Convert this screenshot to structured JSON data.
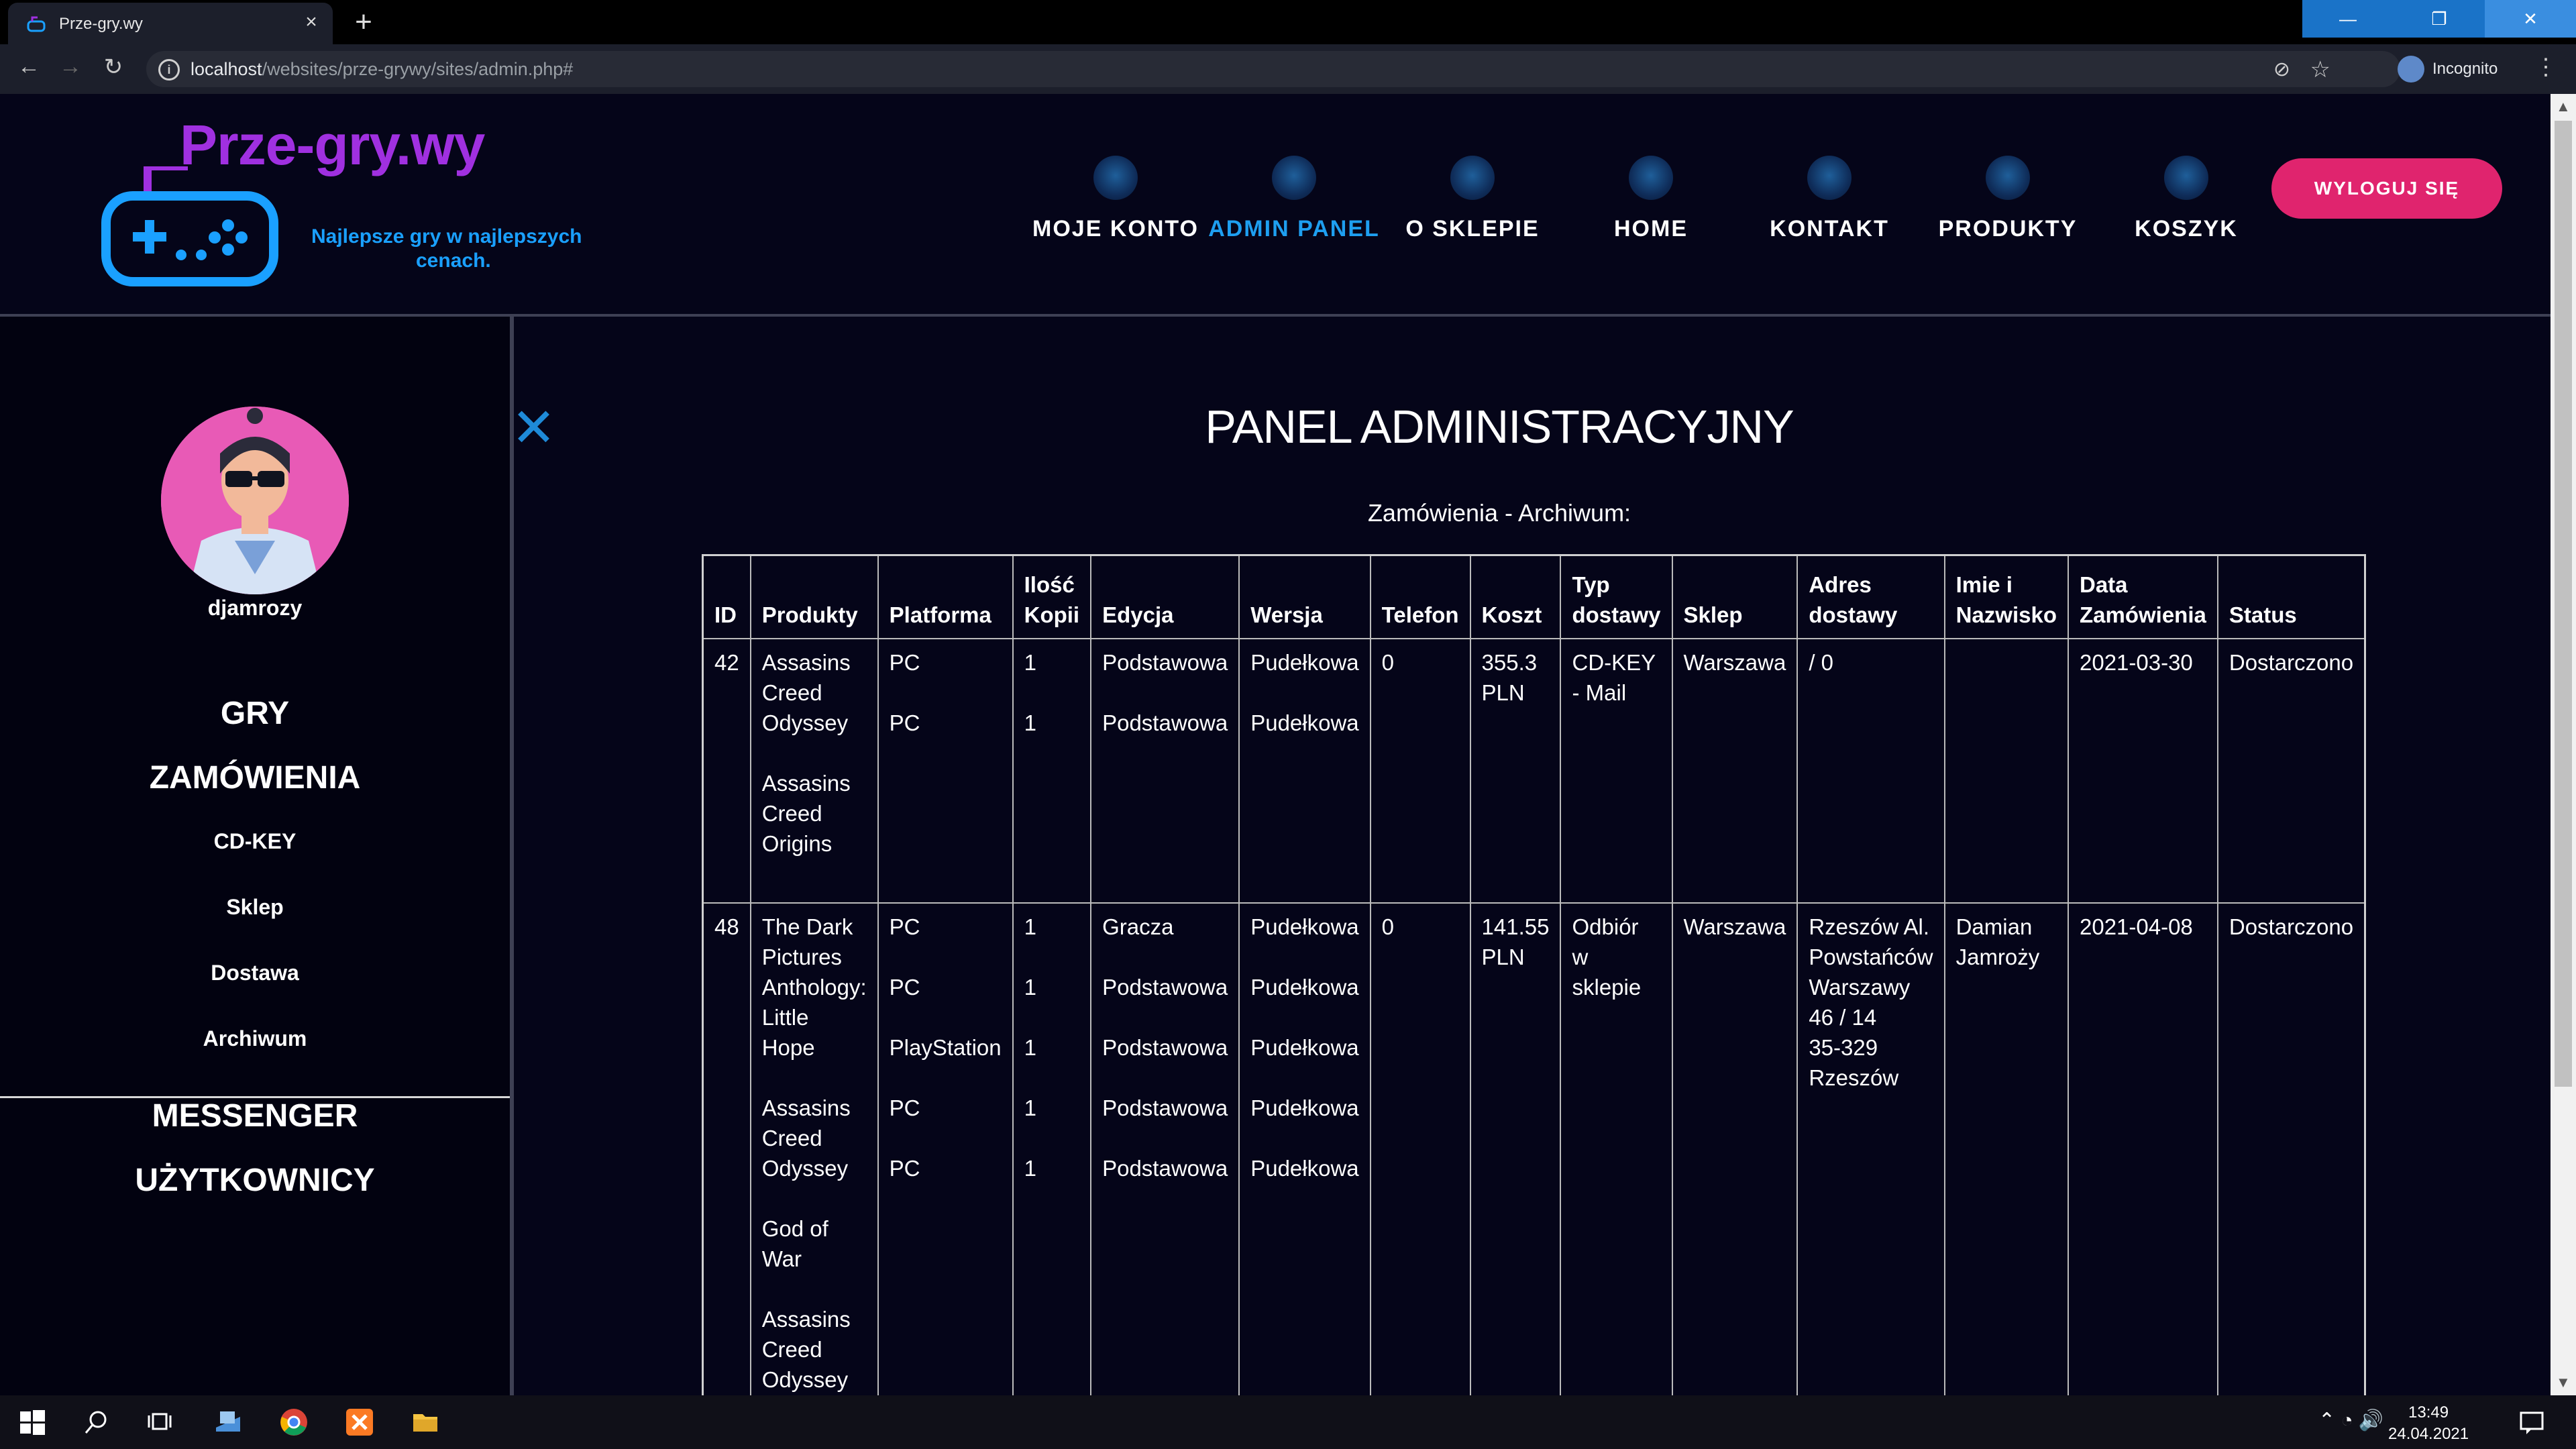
{
  "browser": {
    "tab_title": "Prze-gry.wy",
    "tab_close": "×",
    "new_tab": "+",
    "url_host": "localhost",
    "url_path": "/websites/prze-grywy/sites/admin.php#",
    "profile_label": "Incognito",
    "back": "←",
    "forward": "→",
    "reload": "↻",
    "minimize": "—",
    "restore": "❐",
    "close": "✕"
  },
  "site": {
    "logo_text": "Prze-gry.wy",
    "tagline_line1": "Najlepsze gry w najlepszych",
    "tagline_line2": "cenach.",
    "nav": [
      {
        "label": "MOJE KONTO",
        "icon": "user-icon"
      },
      {
        "label": "ADMIN PANEL",
        "icon": "wrench-icon",
        "active": true
      },
      {
        "label": "O SKLEPIE",
        "icon": "people-icon"
      },
      {
        "label": "HOME",
        "icon": "home-icon"
      },
      {
        "label": "KONTAKT",
        "icon": "phone-icon"
      },
      {
        "label": "PRODUKTY",
        "icon": "gamepad-icon"
      },
      {
        "label": "KOSZYK",
        "icon": "cart-icon"
      }
    ],
    "logout_label": "WYLOGUJ SIĘ"
  },
  "sidebar": {
    "username": "djamrozy",
    "items": [
      "GRY",
      "ZAMÓWIENIA",
      "CD-KEY",
      "Sklep",
      "Dostawa",
      "Archiwum"
    ],
    "bottom_items": [
      "MESSENGER",
      "UŻYTKOWNICY"
    ],
    "close_glyph": "✕"
  },
  "main": {
    "title": "PANEL ADMINISTRACYJNY",
    "section_title": "Zamówienia - Archiwum:",
    "columns": [
      "ID",
      "Produkty",
      "Platforma",
      "Ilość Kopii",
      "Edycja",
      "Wersja",
      "Telefon",
      "Koszt",
      "Typ dostawy",
      "Sklep",
      "Adres dostawy",
      "Imie i Nazwisko",
      "Data Zamówienia",
      "Status"
    ],
    "rows": [
      {
        "id": "42",
        "products": [
          [
            "Assasins",
            "Creed",
            "Odyssey"
          ],
          [
            "Assasins",
            "Creed",
            "Origins"
          ]
        ],
        "platforms": [
          "PC",
          "PC"
        ],
        "copies": [
          "1",
          "1"
        ],
        "editions": [
          "Podstawowa",
          "Podstawowa"
        ],
        "versions": [
          "Pudełkowa",
          "Pudełkowa"
        ],
        "phone": "0",
        "cost": [
          "355.3",
          "PLN"
        ],
        "delivery": [
          "CD-KEY",
          "- Mail"
        ],
        "shop": "Warszawa",
        "address": [
          "/ 0"
        ],
        "name": [],
        "date": "2021-03-30",
        "status": "Dostarczono"
      },
      {
        "id": "48",
        "products": [
          [
            "The Dark",
            "Pictures",
            "Anthology:",
            "Little",
            "Hope"
          ],
          [
            "Assasins",
            "Creed",
            "Odyssey"
          ],
          [
            "God of",
            "War"
          ],
          [
            "Assasins",
            "Creed",
            "Odyssey"
          ]
        ],
        "platforms": [
          "PC",
          "PC",
          "PlayStation",
          "PC",
          "PC"
        ],
        "copies": [
          "1",
          "1",
          "1",
          "1",
          "1"
        ],
        "editions": [
          "Gracza",
          "Podstawowa",
          "Podstawowa",
          "Podstawowa",
          "Podstawowa"
        ],
        "versions": [
          "Pudełkowa",
          "Pudełkowa",
          "Pudełkowa",
          "Pudełkowa",
          "Pudełkowa"
        ],
        "phone": "0",
        "cost": [
          "141.55",
          "PLN"
        ],
        "delivery": [
          "Odbiór w",
          "sklepie"
        ],
        "shop": "Warszawa",
        "address": [
          "Rzeszów Al.",
          "Powstańców",
          "Warszawy",
          "46 / 14",
          "35-329",
          "Rzeszów"
        ],
        "name": [
          "Damian",
          "Jamroży"
        ],
        "date": "2021-04-08",
        "status": "Dostarczono"
      }
    ]
  },
  "taskbar": {
    "time": "13:49",
    "date": "24.04.2021"
  },
  "colors": {
    "accent_blue": "#1e9ff0",
    "logout_pink": "#e0246e",
    "logo_purple": "#a030e0",
    "background": "#050519"
  }
}
